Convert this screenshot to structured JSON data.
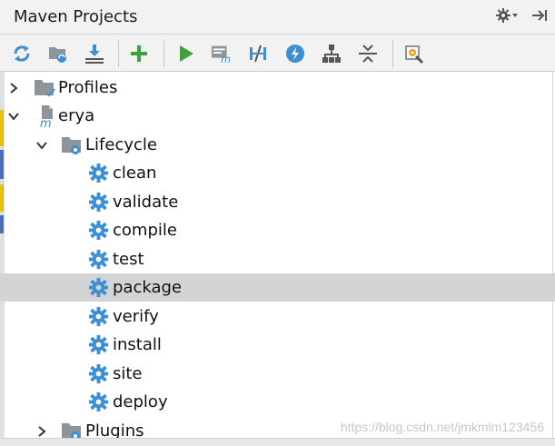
{
  "panel": {
    "title": "Maven Projects",
    "settings_icon": "gear-dropdown-icon",
    "hide_icon": "hide-panel-icon"
  },
  "toolbar": [
    {
      "name": "reimport-icon"
    },
    {
      "name": "generate-sources-icon"
    },
    {
      "name": "download-sources-icon"
    },
    {
      "name": "add-maven-project-icon"
    },
    {
      "name": "run-maven-build-icon"
    },
    {
      "name": "execute-maven-goal-icon"
    },
    {
      "name": "toggle-offline-mode-icon"
    },
    {
      "name": "toggle-skip-tests-icon"
    },
    {
      "name": "show-dependencies-icon"
    },
    {
      "name": "collapse-all-icon"
    },
    {
      "name": "maven-settings-icon"
    }
  ],
  "tree": {
    "profiles": "Profiles",
    "project": "erya",
    "lifecycle": "Lifecycle",
    "goals": [
      "clean",
      "validate",
      "compile",
      "test",
      "package",
      "verify",
      "install",
      "site",
      "deploy"
    ],
    "selected_goal": "package",
    "plugins": "Plugins"
  },
  "watermark": "https://blog.csdn.net/jmkmlm123456",
  "colors": {
    "accent_blue": "#3d8fd1",
    "run_green": "#3da13d",
    "selection": "#d4d4d4"
  }
}
